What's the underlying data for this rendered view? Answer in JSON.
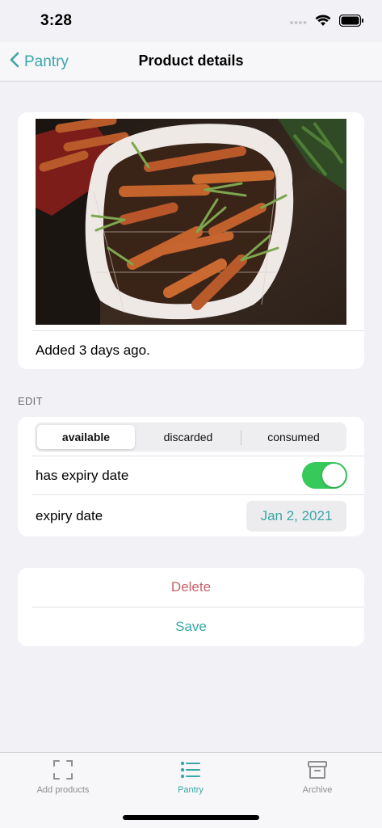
{
  "status": {
    "time": "3:28"
  },
  "nav": {
    "back_label": "Pantry",
    "title": "Product details"
  },
  "photo": {
    "subject": "carrots"
  },
  "product": {
    "added_text": "Added 3 days ago."
  },
  "edit": {
    "section_header": "EDIT",
    "segments": [
      "available",
      "discarded",
      "consumed"
    ],
    "selected_segment": "available",
    "expiry_toggle_label": "has expiry date",
    "expiry_toggle_on": true,
    "expiry_date_label": "expiry date",
    "expiry_date_value": "Jan 2, 2021"
  },
  "actions": {
    "delete_label": "Delete",
    "save_label": "Save"
  },
  "tabs": [
    {
      "label": "Add products",
      "icon": "scan-icon"
    },
    {
      "label": "Pantry",
      "icon": "list-icon",
      "active": true
    },
    {
      "label": "Archive",
      "icon": "archive-icon"
    }
  ],
  "colors": {
    "accent": "#3aa6a6",
    "destructive": "#c8606a",
    "toggle_on": "#37c95a",
    "background": "#f2f2f6"
  }
}
